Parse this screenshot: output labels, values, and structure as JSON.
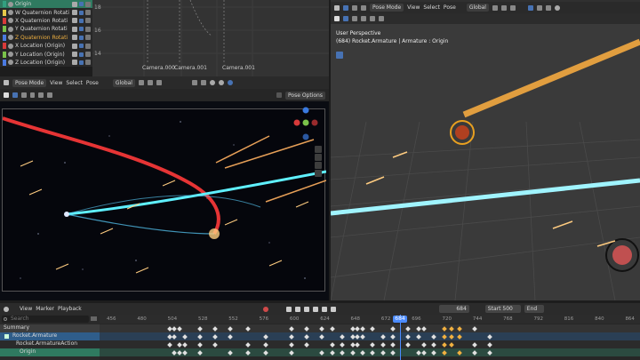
{
  "outliner": {
    "rows": [
      {
        "label": "Origin",
        "color": "#33a080",
        "selected": true
      },
      {
        "label": "W Quaternion Rotati",
        "color": "#e6c84a"
      },
      {
        "label": "X Quaternion Rotati",
        "color": "#d83a3a"
      },
      {
        "label": "Y Quaternion Rotati",
        "color": "#7ac24a"
      },
      {
        "label": "Z Quaternion Rotati",
        "color": "#4a7ae0",
        "highlight": true
      },
      {
        "label": "X Location (Origin)",
        "color": "#d83a3a"
      },
      {
        "label": "Y Location (Origin)",
        "color": "#7ac24a"
      },
      {
        "label": "Z Location (Origin)",
        "color": "#4a7ae0"
      }
    ]
  },
  "graph": {
    "ticks": [
      "18",
      "16",
      "14"
    ],
    "markers": [
      "Camera.000",
      "Camera.001",
      "Camera.001"
    ]
  },
  "viewport_left": {
    "mode": "Pose Mode",
    "menus": [
      "View",
      "Select",
      "Pose"
    ],
    "orientation": "Global",
    "pose_options": "Pose Options"
  },
  "viewport_right": {
    "mode": "Pose Mode",
    "menus": [
      "View",
      "Select",
      "Pose"
    ],
    "orientation": "Global",
    "title": "User Perspective",
    "subtitle": "(684) Rocket.Armature | Armature : Origin"
  },
  "timeline": {
    "menus": [
      "View",
      "Marker",
      "Playback"
    ],
    "current_frame": "684",
    "start_label": "Start",
    "start": "500",
    "end_label": "End",
    "ruler": [
      "456",
      "480",
      "504",
      "528",
      "552",
      "576",
      "600",
      "624",
      "648",
      "672",
      "684",
      "696",
      "720",
      "744",
      "768",
      "792",
      "816",
      "840",
      "864"
    ],
    "search_placeholder": "Search",
    "channels": [
      {
        "label": "Summary"
      },
      {
        "label": "Rocket.Armature"
      },
      {
        "label": "Rocket.ArmatureAction"
      },
      {
        "label": "Origin"
      }
    ]
  }
}
